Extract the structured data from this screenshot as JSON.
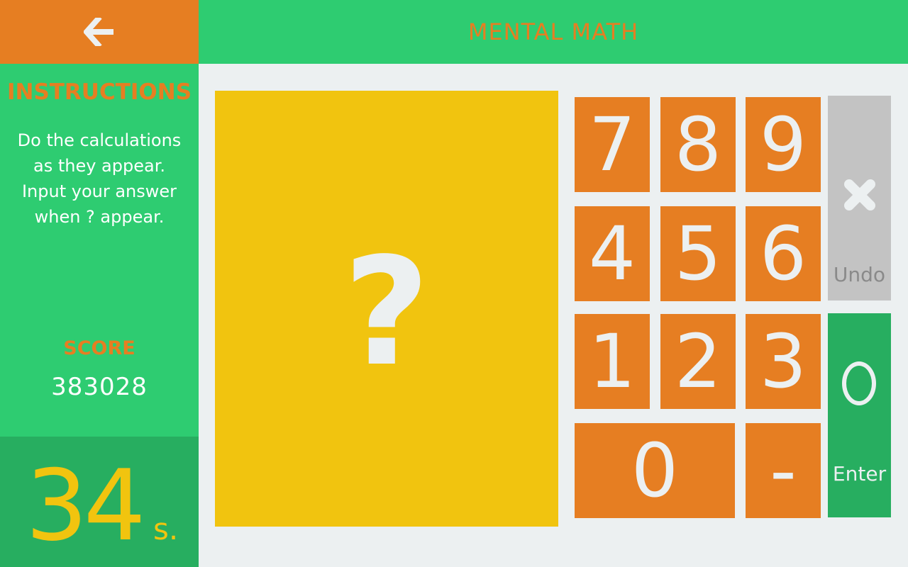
{
  "header": {
    "title": "MENTAL MATH"
  },
  "back_button": {
    "icon": "arrow-left-icon"
  },
  "sidebar": {
    "instructions_title": "INSTRUCTIONS",
    "instructions_lines": [
      "Do the calculations",
      "as they appear.",
      "Input your answer",
      "when ? appear."
    ],
    "score_label": "SCORE",
    "score_value": "383028"
  },
  "timer": {
    "value": "34",
    "unit": "s."
  },
  "display": {
    "text": "?"
  },
  "keypad": {
    "keys": [
      "7",
      "8",
      "9",
      "4",
      "5",
      "6",
      "1",
      "2",
      "3",
      "0",
      "-"
    ],
    "undo_label": "Undo",
    "undo_icon": "close-icon",
    "enter_label": "Enter",
    "enter_icon": "circle-icon"
  },
  "colors": {
    "orange": "#e67e22",
    "green": "#2ecc71",
    "dark_green": "#27ae60",
    "yellow": "#f1c40f",
    "gray": "#c3c3c3",
    "background": "#ecf0f1"
  }
}
